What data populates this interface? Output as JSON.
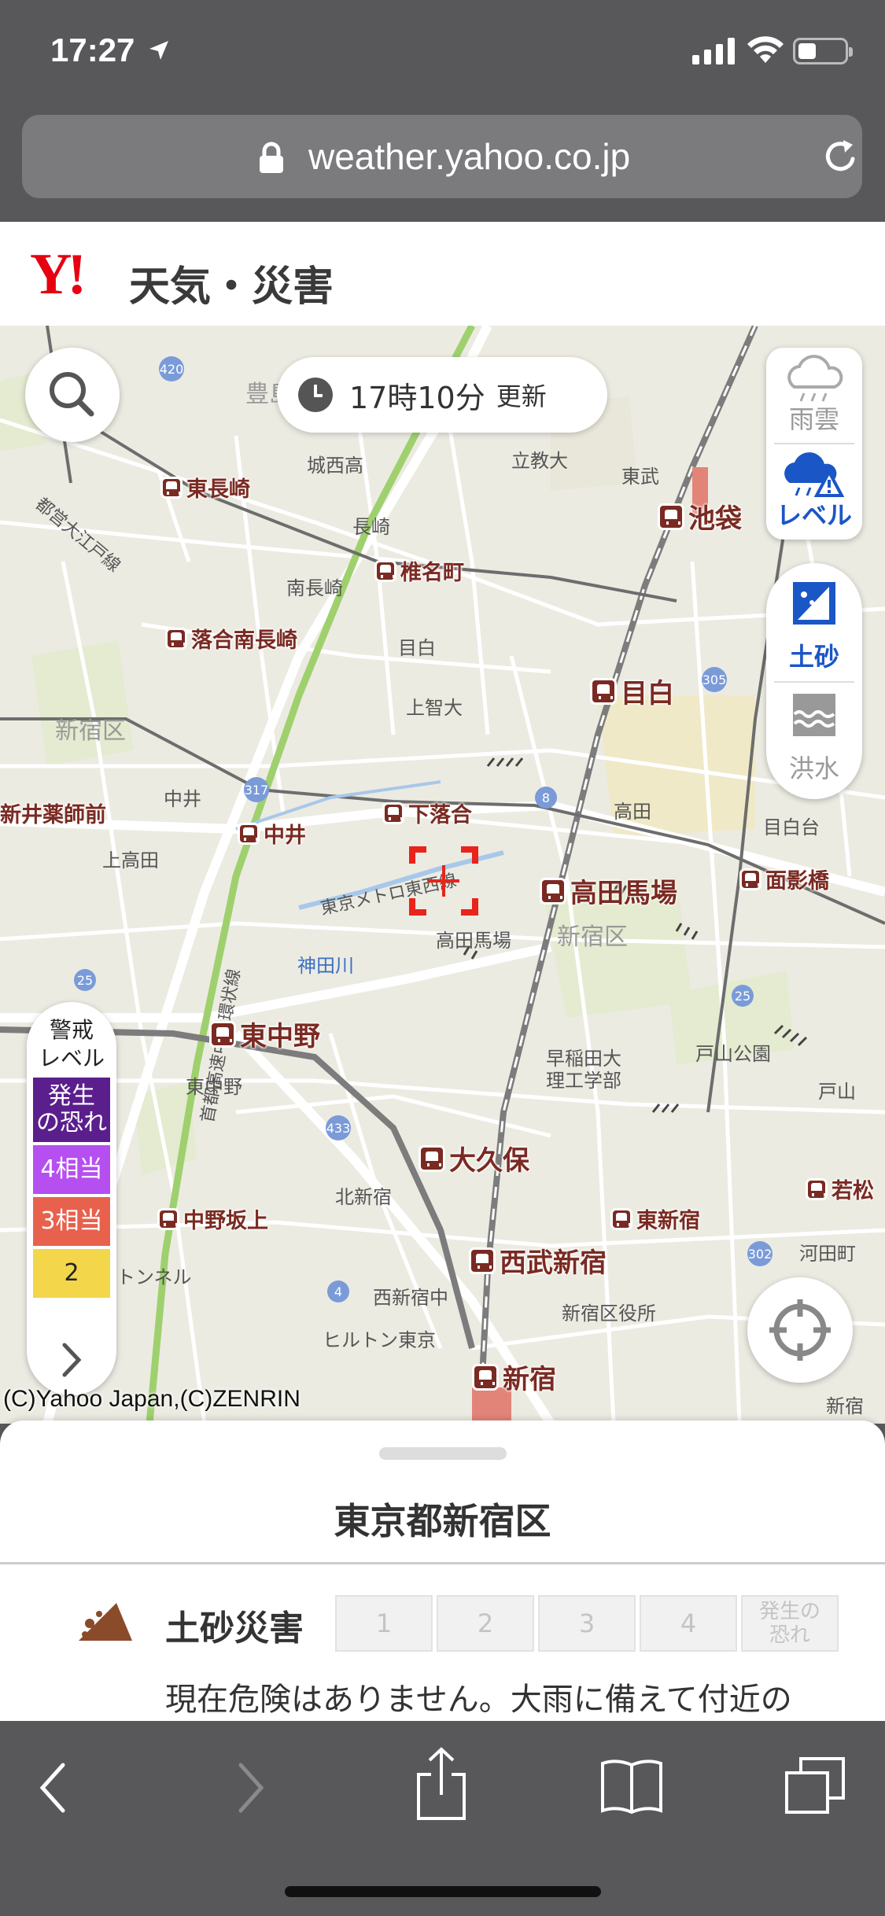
{
  "status": {
    "time": "17:27"
  },
  "browser": {
    "url": "weather.yahoo.co.jp"
  },
  "site": {
    "logo_y": "Y!",
    "logo_text": "天気・災害"
  },
  "map": {
    "update_time": "17時10分",
    "update_suffix": "更新",
    "layers": [
      {
        "label": "雨雲",
        "active": false
      },
      {
        "label": "レベル",
        "active": true
      }
    ],
    "hazards": [
      {
        "label": "土砂",
        "active": true
      },
      {
        "label": "洪水",
        "active": false
      }
    ],
    "legend": {
      "title": "警戒\nレベル",
      "items": [
        {
          "label": "発生\nの恐れ",
          "color": "#5a1f8c"
        },
        {
          "label": "4相当",
          "color": "#b64ff0"
        },
        {
          "label": "3相当",
          "color": "#e8614d"
        },
        {
          "label": "2",
          "color": "#f3d64a"
        }
      ]
    },
    "copyright": "(C)Yahoo Japan,(C)ZENRIN",
    "stations": {
      "ikebukuro": "池袋",
      "takadanobaba": "高田馬場",
      "mejiro": "目白",
      "higashinakano": "東中野",
      "okubo": "大久保",
      "seibushinjuku": "西武新宿",
      "shinjuku": "新宿",
      "higashinagasaki": "東長崎",
      "shiinamachi": "椎名町",
      "ochiaiminaminagasaki": "落合南長崎",
      "shimoochiai": "下落合",
      "nakai": "中井",
      "nakanosakaue": "中野坂上",
      "higashishinjuku": "東新宿",
      "wakamatsu": "若松",
      "omokagebashi": "面影橋",
      "shinaraiyakushi": "新井薬師前"
    },
    "labels": {
      "shinjuku_ku_1": "新宿区",
      "shinjuku_ku_2": "新宿区",
      "toshima_ku": "豊島区",
      "josai": "城西高",
      "rikkyo": "立教大",
      "higashiikebukuro": "東武",
      "nagasaki": "長崎",
      "minaminagasaki": "南長崎",
      "mejiro_area": "目白",
      "jochi": "上智大",
      "kamitakada": "上高田",
      "nakai_area": "中井",
      "takada": "高田",
      "mejirodai": "目白台",
      "waseda": "早稲田大\n理工学部",
      "toyama": "戸山公園",
      "toyama2": "戸山",
      "kandagawa": "神田川",
      "takadanobaba_area": "高田馬場",
      "higashinakano_area": "東中野",
      "kitashinjuku": "北新宿",
      "nishishinjuku": "西新宿中",
      "hilton": "ヒルトン東京",
      "ward_office": "新宿区役所",
      "shinjuku_area": "新宿",
      "kawadacho": "河田町",
      "yamate_tunnel": "山手トンネル",
      "tozai": "東京メトロ東西線",
      "shuto": "首都高速中央環状線",
      "oedo": "都営大江戸線"
    }
  },
  "sheet": {
    "title": "東京都新宿区",
    "hazard_name": "土砂災害",
    "levels": [
      "1",
      "2",
      "3",
      "4",
      "発生の\n恐れ"
    ],
    "description": "現在危険はありません。大雨に備えて付近の"
  }
}
